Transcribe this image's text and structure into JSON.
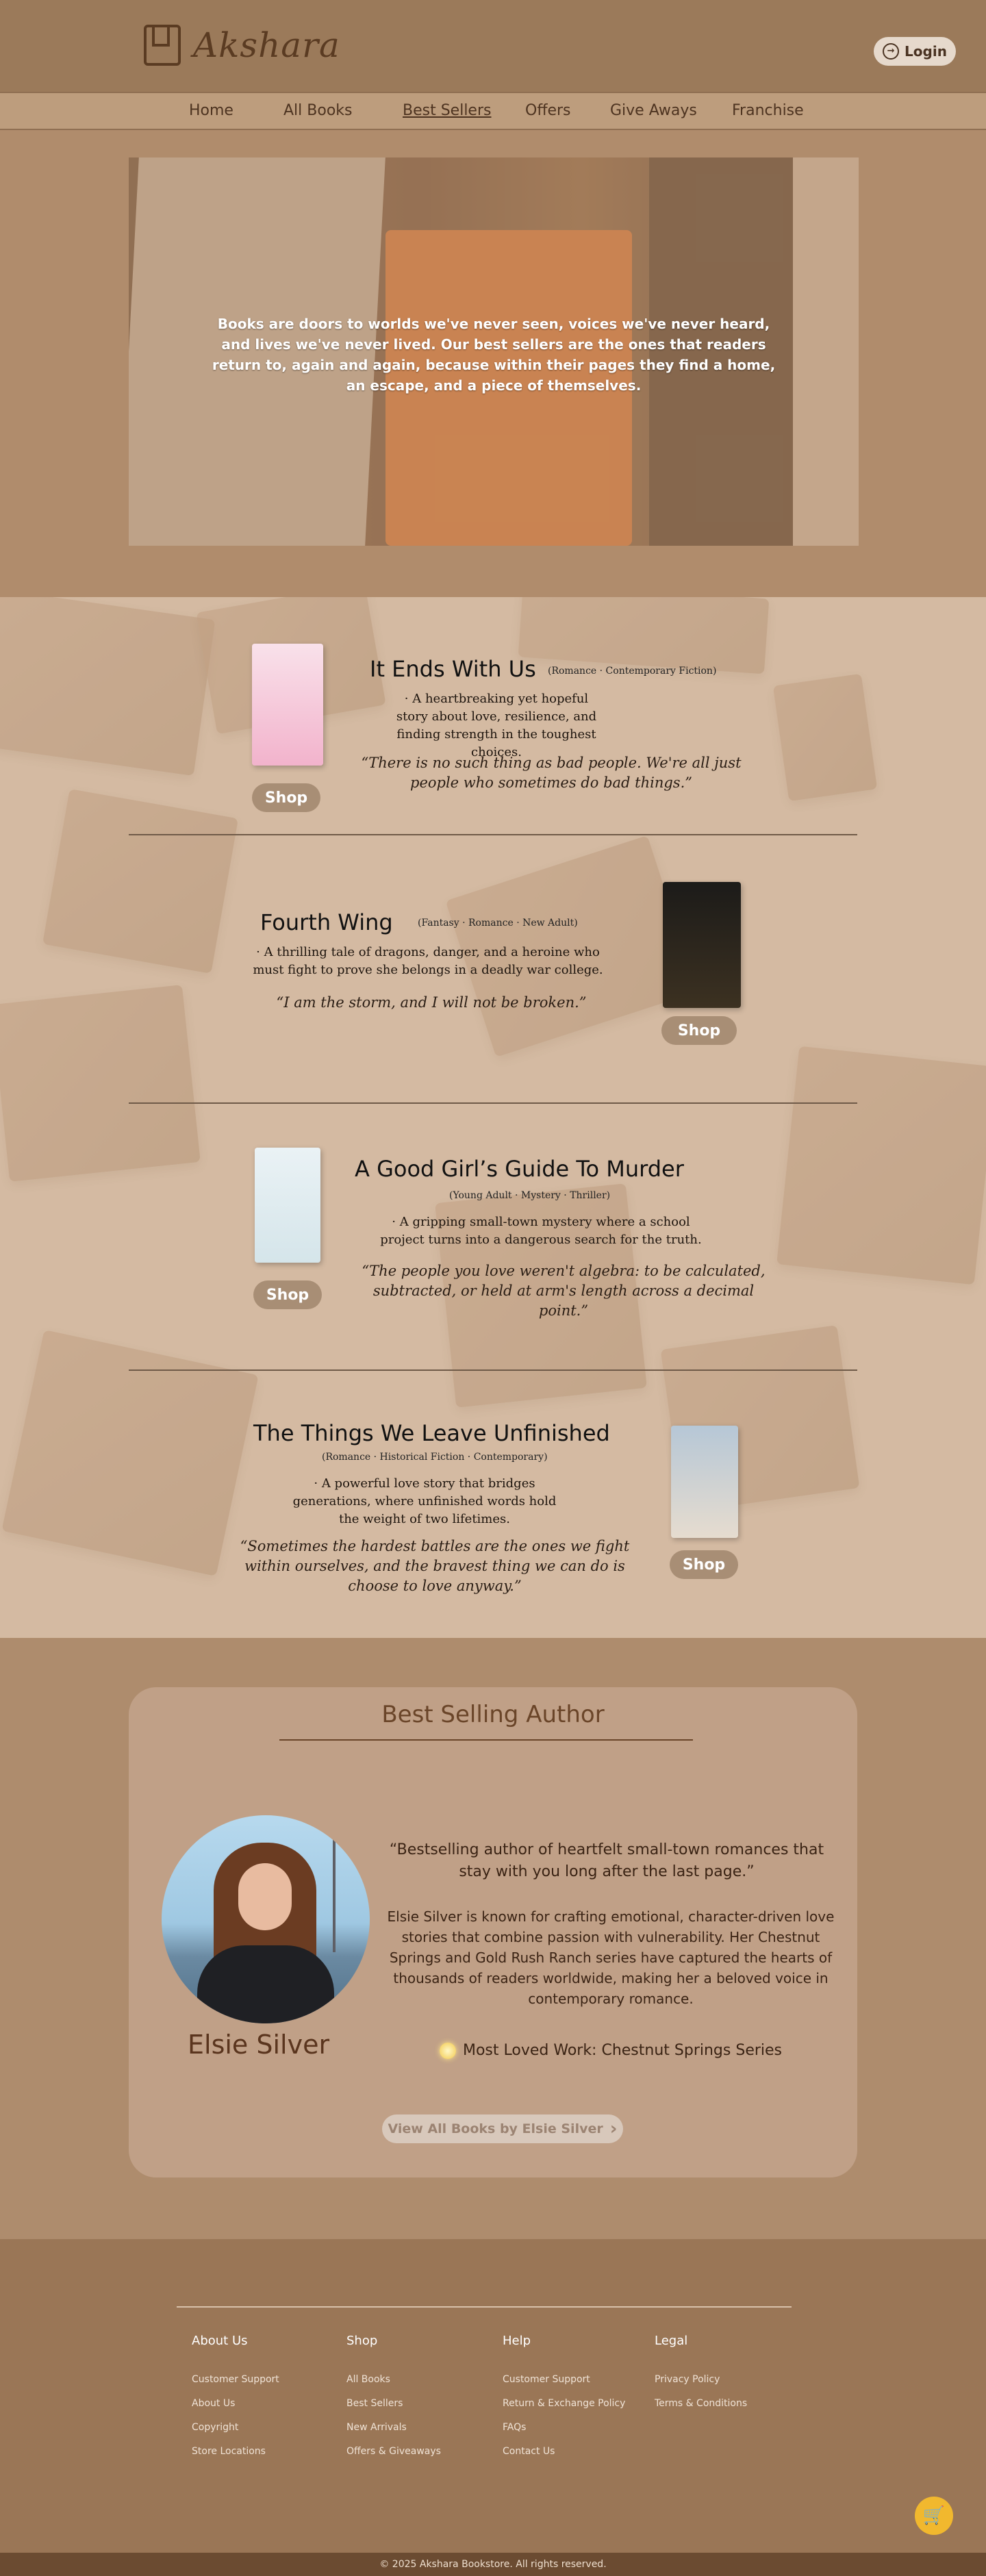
{
  "brand": {
    "name": "Akshara"
  },
  "header": {
    "login_label": "Login"
  },
  "nav": [
    "Home",
    "All Books",
    "Best Sellers",
    "Offers",
    "Give Aways",
    "Franchise"
  ],
  "hero": {
    "quote": "Books are doors to worlds we've never seen, voices we've never heard, and lives we've never lived. Our best sellers are the ones that readers return to, again and again, because within their pages they find a home, an escape, and a piece of themselves."
  },
  "books": [
    {
      "title": "It Ends With Us",
      "genre": "(Romance · Contemporary Fiction)",
      "description": "·  A heartbreaking yet hopeful story about love, resilience, and finding strength in the toughest choices.",
      "quote": "“There is no such thing as bad people. We're all just people who sometimes do bad things.”",
      "shop": "Shop"
    },
    {
      "title": "Fourth Wing",
      "genre": "(Fantasy · Romance · New Adult)",
      "description": "·  A thrilling tale of dragons, danger, and a heroine who must fight to prove she belongs in a deadly war college.",
      "quote": "“I am the storm, and I will not be broken.”",
      "shop": "Shop"
    },
    {
      "title": "A Good Girl’s Guide  To Murder",
      "genre": "(Young Adult · Mystery · Thriller)",
      "description": "·  A gripping small-town mystery where a school project turns into a dangerous search for the truth.",
      "quote": "“The people you love weren't algebra: to be calculated, subtracted, or held at arm's length across a decimal point.”",
      "shop": "Shop"
    },
    {
      "title": "The Things We Leave Unfinished",
      "genre": "(Romance · Historical Fiction · Contemporary)",
      "description": "·  A powerful love story that bridges generations, where unfinished words hold the weight of two lifetimes.",
      "quote": "“Sometimes the hardest battles are the ones we fight within ourselves, and the bravest thing we can do is choose to love anyway.”",
      "shop": "Shop"
    }
  ],
  "author": {
    "heading": "Best Selling Author",
    "name": "Elsie Silver",
    "quote": "“Bestselling author of heartfelt small-town romances that stay with you long after the last page.”",
    "bio": "Elsie Silver is known for crafting emotional, character-driven love stories that combine passion with vulnerability. Her Chestnut Springs and Gold Rush Ranch series have captured the hearts of thousands of readers worldwide, making her a beloved voice in contemporary romance.",
    "loved": "Most Loved Work: Chestnut Springs Series",
    "button": "View All Books by Elsie Silver"
  },
  "footer": {
    "columns": [
      {
        "heading": "About Us",
        "links": [
          "Customer Support",
          "About Us",
          "Copyright",
          "Store Locations"
        ]
      },
      {
        "heading": "Shop",
        "links": [
          "All Books",
          "Best Sellers",
          "New Arrivals",
          "Offers & Giveaways"
        ]
      },
      {
        "heading": "Help",
        "links": [
          "Customer Support",
          "Return & Exchange Policy",
          "FAQs",
          "Contact Us"
        ]
      },
      {
        "heading": "Legal",
        "links": [
          "Privacy Policy",
          "Terms & Conditions"
        ]
      }
    ],
    "copyright": "© 2025 Akshara Bookstore. All rights reserved."
  },
  "icons": {
    "logo": "book-logo-icon",
    "login": "login-arrow-icon",
    "star": "star-icon",
    "cart": "cart-icon",
    "chevron": "chevron-right-icon"
  },
  "colors": {
    "header": "#9b7a5a",
    "nav": "#bd9d7d",
    "books_bg": "#d4baa2",
    "author_card": "#c0a087",
    "footer": "#9a7656",
    "accent": "#5a3b22"
  }
}
